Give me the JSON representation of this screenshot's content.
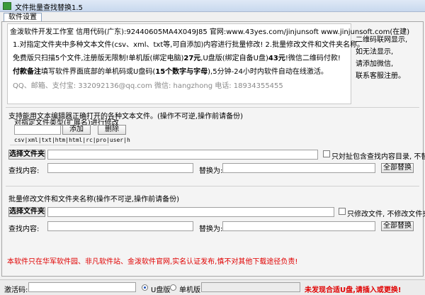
{
  "window": {
    "title": "文件批量查找替换1.5"
  },
  "tab": {
    "label": "软件设置"
  },
  "ad": {
    "line1": "金泼软件开发工作室  信用代码(广东):92440605MA4X049J85 官网:www.43yes.com/jinjunsoft  www.jinjunsoft.com(在建)",
    "line2": "1.对指定文件夹中多种文本文件(csv、xml、txt等,可自添加)内容进行批量修改! 2.批量修改文件和文件夹名称。",
    "line3_a": "免费版只扫描5个文件,注册版无限制!单机版(绑定电脑)",
    "line3_b": "27元",
    "line3_c": ",U盘版(绑定自备U盘)",
    "line3_d": "43元",
    "line3_e": "!微信二维码付款!",
    "line4_a": "付款备注",
    "line4_b": "填写软件界面底部的单机码或U盘码(",
    "line4_c": "15个数字与字母",
    "line4_d": "),5分钟-24小时内软件自动在线激活。",
    "line5": "QQ、邮箱、支付宝: 332092136@qq.com    微信: hangzhong    电话: 18934355455"
  },
  "side": {
    "lines": [
      "二维码联网显示,",
      "如无法显示,",
      "请添加微信,",
      "联系客服注册。"
    ]
  },
  "section1": {
    "title": "支持能用文本编辑器正确打开的各种文本文件。(操作不可逆,操作前请备份)",
    "type_label": "对指定文件类型(扩展名)进行修改",
    "add_button": "添加",
    "delete_button": "删除",
    "extensions": "csv|xml|txt|htm|html|rc|pro|user|h",
    "choose_folder": "选择文件夹",
    "subfolder_checkbox": "只対扯包含查找内容目录, 不替换",
    "find_label": "查找内容:",
    "replace_label": "替换为:",
    "replace_all": "全部替换"
  },
  "section2": {
    "title": "批量修改文件和文件夹名称(操作不可逆,操作前请备份)",
    "choose_folder": "选择文件夹",
    "file_only_checkbox": "只修改文件, 不修改文件夹",
    "find_label": "查找内容:",
    "replace_label": "替换为:",
    "replace_all": "全部替换"
  },
  "notice": "本软件只在华军软件园、非凡软件站、金泼软件官网,实名认证发布,慎不对其他下载途径负责!",
  "status": {
    "activation_label": "激活码:",
    "usb_option": "U盘版",
    "standalone_option": "单机版",
    "warning": "未发现合适U盘,请插入或更换!"
  },
  "colors": {
    "warning": "#e00000",
    "radio_selected": "#1a4fb7"
  }
}
